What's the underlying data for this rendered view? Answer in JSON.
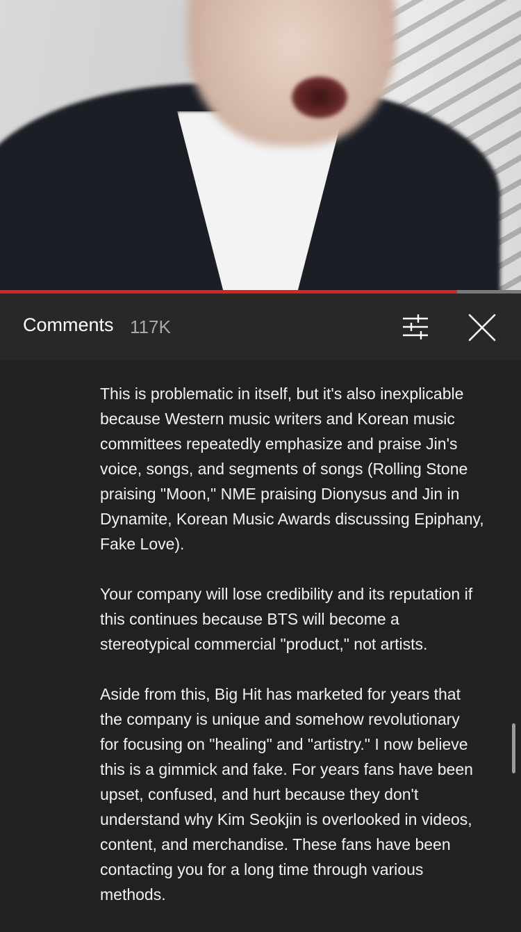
{
  "player": {
    "progress_percent": 87.7
  },
  "comments_panel": {
    "title": "Comments",
    "count": "117K",
    "icons": {
      "filter": "sliders-icon",
      "close": "close-icon"
    },
    "colors": {
      "progress": "#e0221f",
      "background": "#212121",
      "header_background": "#282828"
    }
  },
  "comment": {
    "paragraphs": [
      "This is problematic in itself, but it's also inexplicable\nbecause Western music writers and Korean music\ncommittees repeatedly emphasize and praise Jin's\nvoice, songs, and segments of songs (Rolling Stone\npraising \"Moon,\" NME praising Dionysus and Jin in\nDynamite, Korean Music Awards discussing Epiphany,\nFake Love).",
      "Your company will lose credibility and its reputation if\nthis continues because BTS will become a\nstereotypical commercial \"product,\" not artists.",
      "Aside from this, Big Hit has marketed for years that\nthe company is unique and somehow revolutionary\nfor focusing on \"healing\" and \"artistry.\" I now believe\nthis is a gimmick and fake. For years fans have been\nupset, confused, and hurt because they don't\nunderstand why Kim Seokjin is overlooked in videos,\ncontent, and merchandise. These fans have been\ncontacting you for a long time through various\nmethods."
    ]
  }
}
